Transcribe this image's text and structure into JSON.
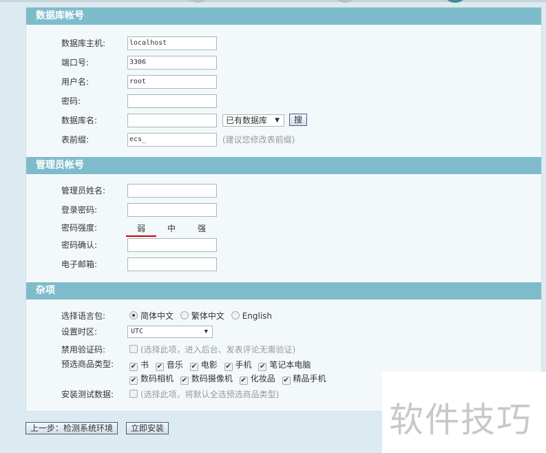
{
  "db": {
    "title": "数据库帐号",
    "host_label": "数据库主机:",
    "host": "localhost",
    "port_label": "端口号:",
    "port": "3306",
    "user_label": "用户名:",
    "user": "root",
    "pass_label": "密码:",
    "pass": "",
    "name_label": "数据库名:",
    "name": "",
    "existing_db": "已有数据库",
    "search": "搜",
    "prefix_label": "表前缀:",
    "prefix": "ecs_",
    "prefix_hint": "(建议您修改表前缀)"
  },
  "admin": {
    "title": "管理员帐号",
    "name_label": "管理员姓名:",
    "pass_label": "登录密码:",
    "strength_label": "密码强度:",
    "strength": [
      "弱",
      "中",
      "强"
    ],
    "confirm_label": "密码确认:",
    "email_label": "电子邮箱:"
  },
  "misc": {
    "title": "杂项",
    "lang_label": "选择语言包:",
    "langs": [
      "简体中文",
      "繁体中文",
      "English"
    ],
    "tz_label": "设置时区:",
    "tz": "UTC",
    "captcha_label": "禁用验证码:",
    "captcha_hint": "(选择此项，进入后台、发表评论无需验证)",
    "goods_label": "预选商品类型:",
    "goods": [
      "书",
      "音乐",
      "电影",
      "手机",
      "笔记本电脑",
      "数码相机",
      "数码摄像机",
      "化妆品",
      "精品手机"
    ],
    "test_label": "安装测试数据:",
    "test_hint": "(选择此项，将默认全选预选商品类型)"
  },
  "buttons": {
    "prev": "上一步：检测系统环境",
    "install": "立即安装"
  },
  "watermark": "软件技巧",
  "colors": {
    "header": "#7fbccb",
    "strength_weak": "#cc0000"
  }
}
